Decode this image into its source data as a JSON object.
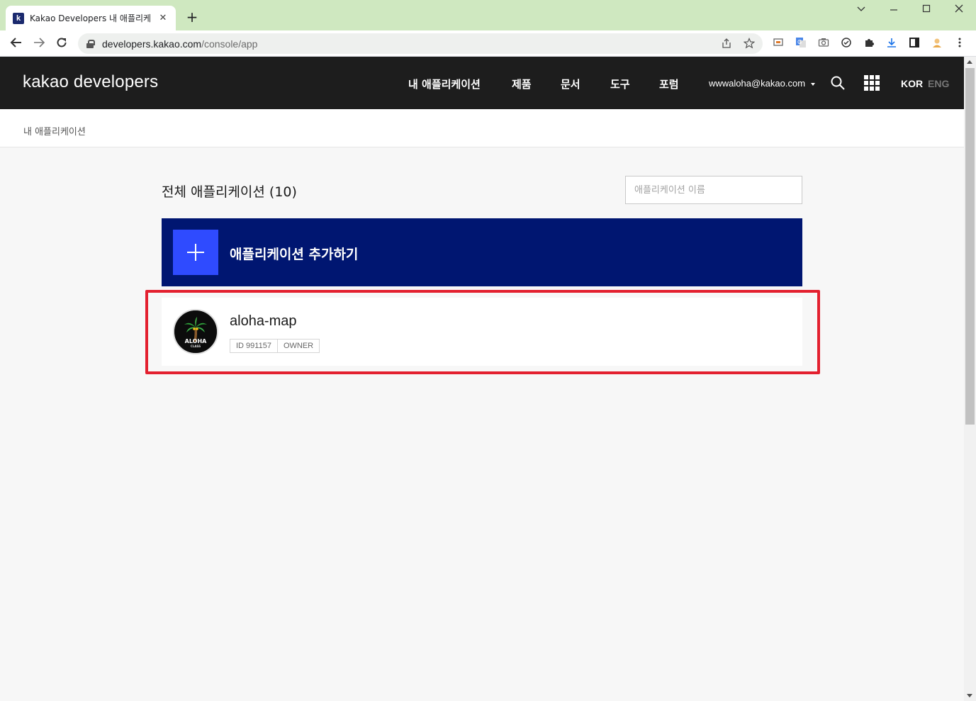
{
  "browser": {
    "tab_title": "Kakao Developers 내 애플리케이션",
    "tab_favicon": "k",
    "url_host": "developers.kakao.com",
    "url_path": "/console/app"
  },
  "header": {
    "logo": "kakao developers",
    "nav": [
      "내 애플리케이션",
      "제품",
      "문서",
      "도구",
      "포럼"
    ],
    "account": "wwwaloha@kakao.com",
    "lang_kor": "KOR",
    "lang_eng": "ENG"
  },
  "breadcrumb": "내 애플리케이션",
  "main": {
    "title": "전체 애플리케이션 (10)",
    "search_placeholder": "애플리케이션 이름",
    "add_label": "애플리케이션 추가하기",
    "apps": [
      {
        "name": "aloha-map",
        "id_tag": "ID 991157",
        "role_tag": "OWNER",
        "logo_text": "ALOHA",
        "logo_subtext": "CLASS"
      }
    ]
  },
  "colors": {
    "header_bg": "#1d1d1d",
    "add_card_bg": "#001671",
    "add_icon_bg": "#2f4bff",
    "highlight": "#e3202f",
    "tabbar_bg": "#cfe8c0"
  }
}
